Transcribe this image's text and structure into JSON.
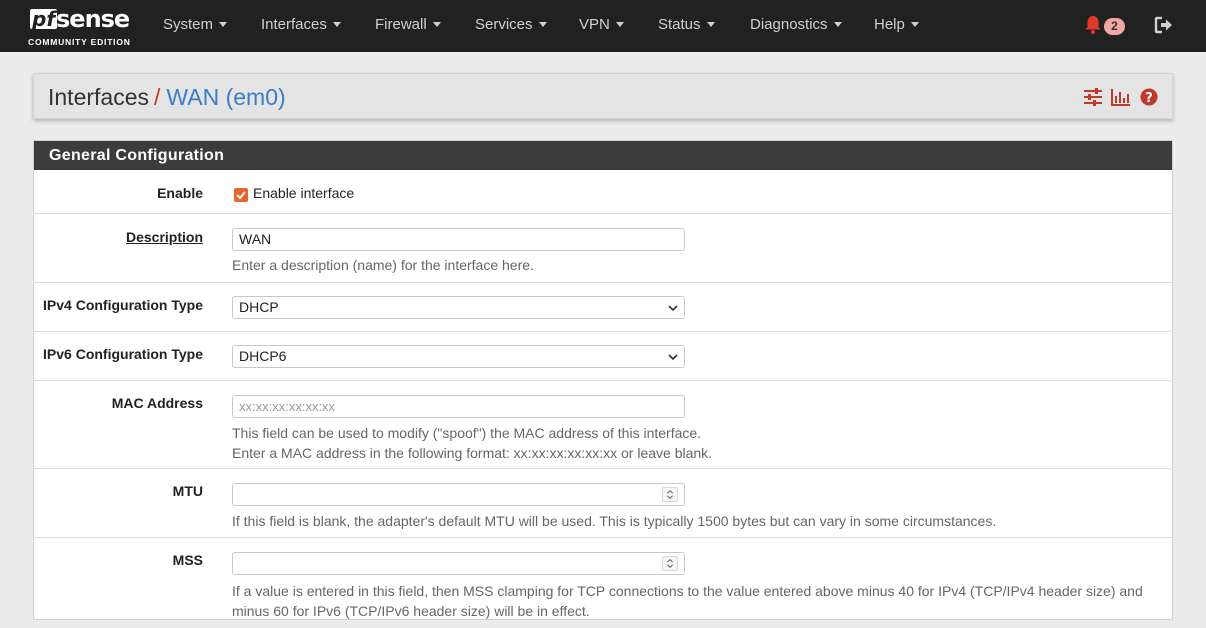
{
  "brand": {
    "logo_pf": "pf",
    "logo_sense": "sense",
    "edition": "COMMUNITY EDITION"
  },
  "nav": {
    "items": [
      {
        "label": "System"
      },
      {
        "label": "Interfaces"
      },
      {
        "label": "Firewall"
      },
      {
        "label": "Services"
      },
      {
        "label": "VPN"
      },
      {
        "label": "Status"
      },
      {
        "label": "Diagnostics"
      },
      {
        "label": "Help"
      }
    ],
    "notifications_count": "2",
    "icons": [
      "bell-icon",
      "logout-icon"
    ]
  },
  "header": {
    "crumb_parent": "Interfaces",
    "separator": "/",
    "crumb_current": "WAN (em0)",
    "icons": [
      "sliders-icon",
      "bar-chart-icon",
      "help-icon"
    ]
  },
  "panel": {
    "title": "General Configuration",
    "enable": {
      "label": "Enable",
      "checkbox_label": "Enable interface",
      "checked": true
    },
    "description": {
      "label": "Description",
      "value": "WAN",
      "help": "Enter a description (name) for the interface here."
    },
    "ipv4": {
      "label": "IPv4 Configuration Type",
      "value": "DHCP"
    },
    "ipv6": {
      "label": "IPv6 Configuration Type",
      "value": "DHCP6"
    },
    "mac": {
      "label": "MAC Address",
      "placeholder": "xx:xx:xx:xx:xx:xx",
      "help_1": "This field can be used to modify (\"spoof\") the MAC address of this interface.",
      "help_2": "Enter a MAC address in the following format: xx:xx:xx:xx:xx:xx or leave blank."
    },
    "mtu": {
      "label": "MTU",
      "value": "",
      "help": "If this field is blank, the adapter's default MTU will be used. This is typically 1500 bytes but can vary in some circumstances."
    },
    "mss": {
      "label": "MSS",
      "value": "",
      "help_1": "If a value is entered in this field, then MSS clamping for TCP connections to the value entered above minus 40 for IPv4 (TCP/IPv4 header size) and",
      "help_2": "minus 60 for IPv6 (TCP/IPv6 header size) will be in effect."
    }
  },
  "colors": {
    "navbar": "#212121",
    "accent_red": "#c0392b",
    "link_blue": "#3a7ec8",
    "checkbox": "#e8652b"
  }
}
